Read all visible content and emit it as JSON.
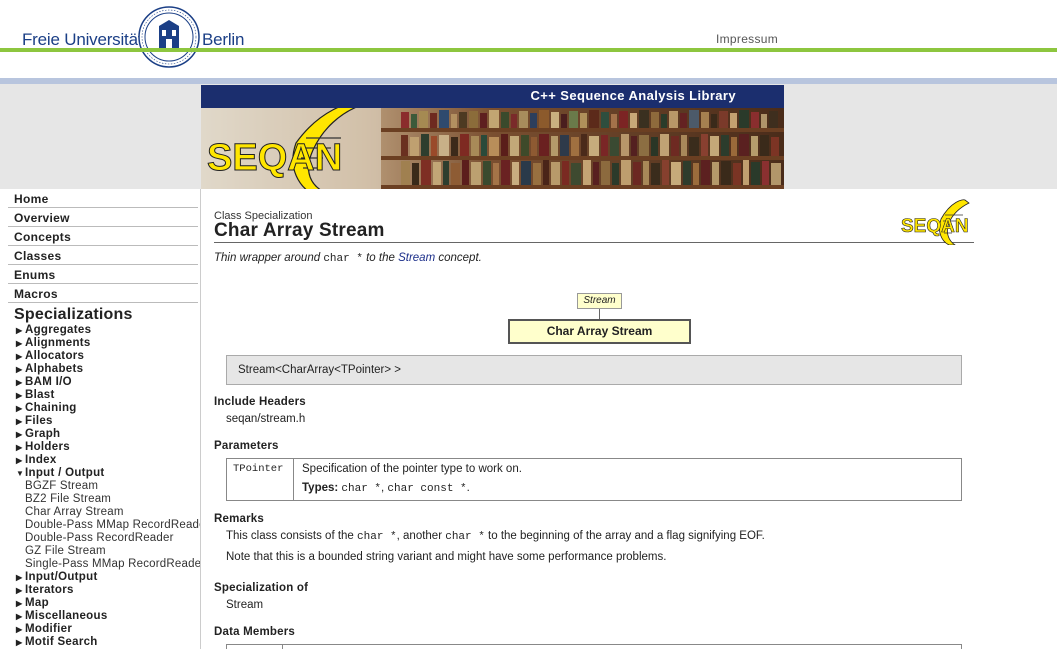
{
  "header": {
    "university_left": "Freie Universität",
    "university_right": "Berlin",
    "impressum": "Impressum"
  },
  "banner": {
    "title": "C++ Sequence Analysis Library",
    "logo_text": "SEQAN"
  },
  "sidebar": {
    "nav": [
      {
        "label": "Home"
      },
      {
        "label": "Overview"
      },
      {
        "label": "Concepts"
      },
      {
        "label": "Classes"
      },
      {
        "label": "Enums"
      },
      {
        "label": "Macros"
      }
    ],
    "heading": "Specializations",
    "tree_top": [
      "Aggregates",
      "Alignments",
      "Allocators",
      "Alphabets",
      "BAM I/O",
      "Blast",
      "Chaining",
      "Files",
      "Graph",
      "Holders",
      "Index"
    ],
    "expanded": {
      "label": "Input / Output",
      "children": [
        "BGZF Stream",
        "BZ2 File Stream",
        "Char Array Stream",
        "Double-Pass MMap RecordReader",
        "Double-Pass RecordReader",
        "GZ File Stream",
        "Single-Pass MMap RecordReader"
      ]
    },
    "tree_bottom": [
      "Input/Output",
      "Iterators",
      "Map",
      "Miscellaneous",
      "Modifier",
      "Motif Search"
    ]
  },
  "content": {
    "kind": "Class Specialization",
    "title": "Char Array Stream",
    "summary": {
      "pre": "Thin wrapper around ",
      "code": "char *",
      "mid": " to the ",
      "link": "Stream",
      "post": " concept."
    },
    "diagram": {
      "parent": "Stream",
      "class": "Char Array Stream"
    },
    "signature": "Stream<CharArray<TPointer> >",
    "include_headers": {
      "heading": "Include Headers",
      "value": "seqan/stream.h"
    },
    "parameters": {
      "heading": "Parameters",
      "name": "TPointer",
      "description": "Specification of the pointer type to work on.",
      "types_label": "Types:",
      "types_value_1": "char *",
      "types_sep": ", ",
      "types_value_2": "char const *",
      "types_end": "."
    },
    "remarks": {
      "heading": "Remarks",
      "line1_a": "This class consists of the ",
      "line1_code1": "char *",
      "line1_b": ", another ",
      "line1_code2": "char *",
      "line1_c": " to the beginning of the array and a flag signifying EOF.",
      "line2": "Note that this is a bounded string variant and might have some performance problems."
    },
    "specialization_of": {
      "heading": "Specialization of",
      "link": "Stream"
    },
    "data_members": {
      "heading": "Data Members"
    }
  },
  "colors": {
    "fu_blue": "#1b3f86",
    "fu_green": "#8dc63f",
    "banner_navy": "#1b2e6e",
    "seqan_yellow": "#ffe600",
    "diagram_fill": "#ffffcc",
    "link": "#1b2e8a"
  }
}
